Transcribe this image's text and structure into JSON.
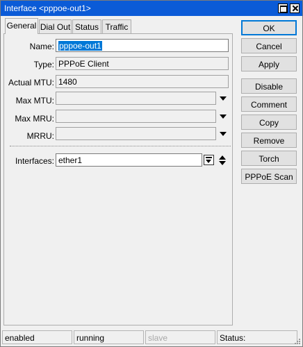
{
  "window": {
    "title": "Interface <pppoe-out1>"
  },
  "tabs": [
    {
      "label": "General",
      "active": true
    },
    {
      "label": "Dial Out",
      "active": false
    },
    {
      "label": "Status",
      "active": false
    },
    {
      "label": "Traffic",
      "active": false
    }
  ],
  "form": {
    "name": {
      "label": "Name:",
      "value": "pppoe-out1"
    },
    "type": {
      "label": "Type:",
      "value": "PPPoE Client"
    },
    "actual_mtu": {
      "label": "Actual MTU:",
      "value": "1480"
    },
    "max_mtu": {
      "label": "Max MTU:",
      "value": ""
    },
    "max_mru": {
      "label": "Max MRU:",
      "value": ""
    },
    "mrru": {
      "label": "MRRU:",
      "value": ""
    },
    "interfaces": {
      "label": "Interfaces:",
      "value": "ether1"
    }
  },
  "buttons": {
    "ok": "OK",
    "cancel": "Cancel",
    "apply": "Apply",
    "disable": "Disable",
    "comment": "Comment",
    "copy": "Copy",
    "remove": "Remove",
    "torch": "Torch",
    "pppoe_scan": "PPPoE Scan"
  },
  "status_bar": {
    "enabled": "enabled",
    "running": "running",
    "slave": "slave",
    "status_label": "Status:"
  },
  "colors": {
    "titlebar": "#0b5bd7",
    "selection": "#0078d7",
    "window_bg": "#f0f0f0"
  }
}
